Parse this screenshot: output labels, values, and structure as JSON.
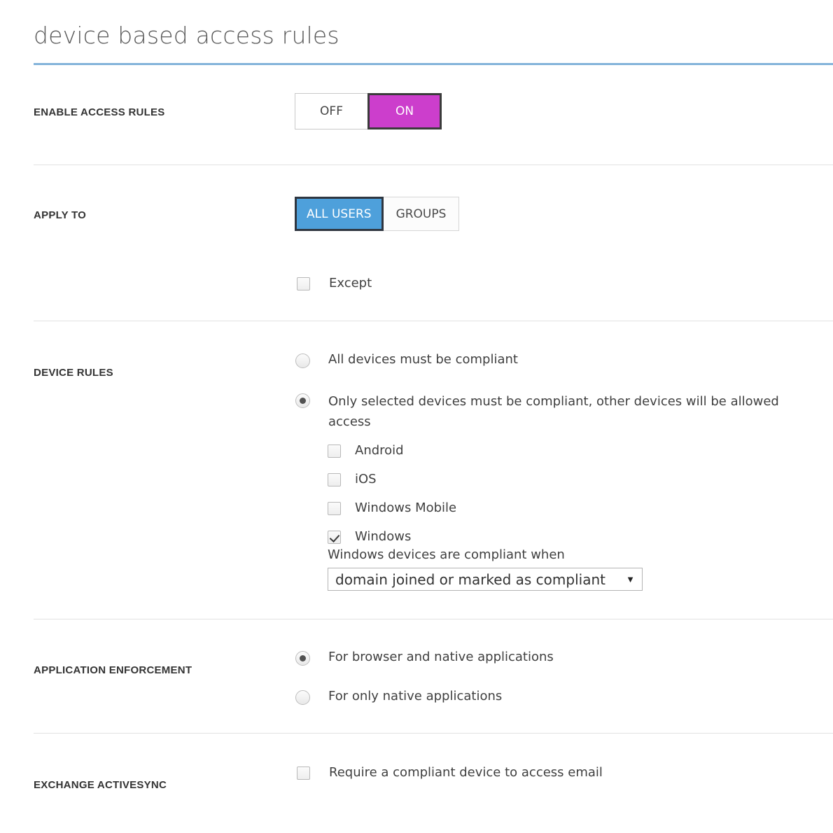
{
  "page": {
    "title": "device based access rules",
    "accent_blue": "#83b3da",
    "toggle_on_color": "#cc3ecc",
    "segment_active_color": "#4ea0db"
  },
  "sections": {
    "enable_access_rules": {
      "label": "ENABLE ACCESS RULES",
      "toggle": {
        "off_label": "OFF",
        "on_label": "ON",
        "selected": "ON"
      }
    },
    "apply_to": {
      "label": "APPLY TO",
      "segments": {
        "all_users_label": "ALL USERS",
        "groups_label": "GROUPS",
        "selected": "ALL USERS"
      },
      "except": {
        "label": "Except",
        "checked": false
      }
    },
    "device_rules": {
      "label": "DEVICE RULES",
      "options": [
        {
          "label": "All devices must be compliant",
          "selected": false
        },
        {
          "label": "Only selected devices must be compliant, other devices will be allowed access",
          "selected": true
        }
      ],
      "devices": [
        {
          "label": "Android",
          "checked": false
        },
        {
          "label": "iOS",
          "checked": false
        },
        {
          "label": "Windows Mobile",
          "checked": false
        },
        {
          "label": "Windows",
          "checked": true
        }
      ],
      "compliance_hint": "Windows devices are compliant when",
      "compliance_select": {
        "value": "domain joined or marked as compliant",
        "arrow_icon": "chevron-down-icon"
      }
    },
    "application_enforcement": {
      "label": "APPLICATION ENFORCEMENT",
      "options": [
        {
          "label": "For browser and native applications",
          "selected": true
        },
        {
          "label": "For only native applications",
          "selected": false
        }
      ]
    },
    "exchange_activesync": {
      "label": "EXCHANGE ACTIVESYNC",
      "require_compliant": {
        "label": "Require a compliant device to access email",
        "checked": false
      }
    }
  }
}
